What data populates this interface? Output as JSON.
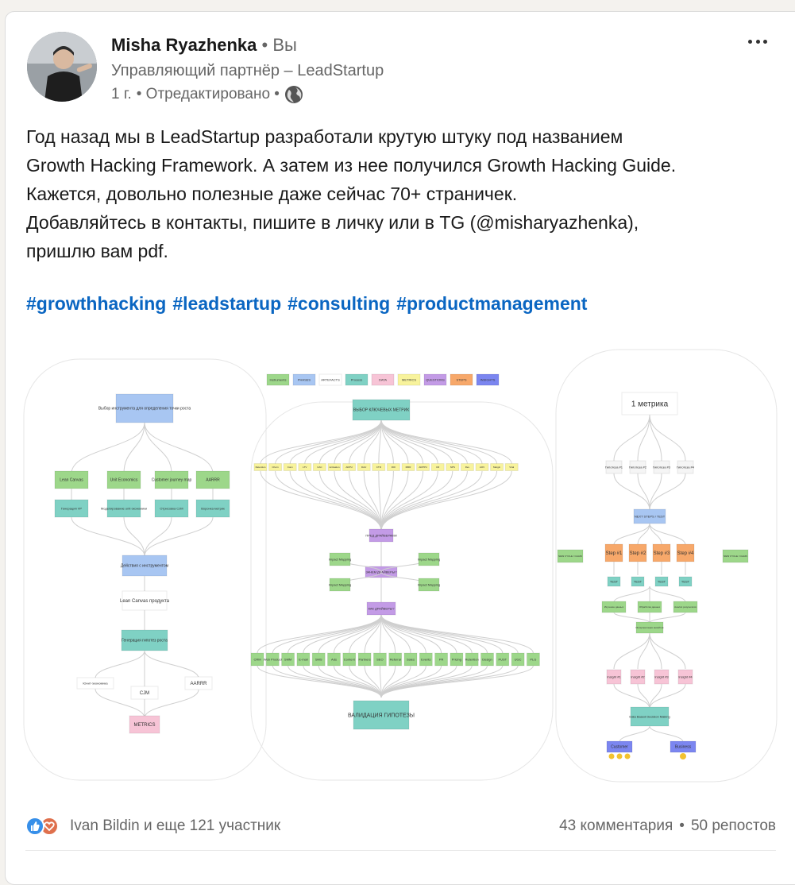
{
  "post": {
    "author_name": "Misha Ryazhenka",
    "author_badge": "• Вы",
    "author_headline": "Управляющий партнёр – LeadStartup",
    "time": "1 г.",
    "edited": "• Отредактировано •",
    "body_lines": [
      "Год назад мы в LeadStartup разработали крутую штуку под названием",
      "Growth Hacking Framework. А затем из нее получился Growth Hacking Guide.",
      "Кажется, довольно полезные даже сейчас 70+ страничек.",
      "Добавляйтесь в контакты, пишите в личку или в TG (@misharyazhenka),",
      "пришлю вам pdf."
    ],
    "hashtags": [
      "#growthhacking",
      "#leadstartup",
      "#consulting",
      "#productmanagement"
    ]
  },
  "framework": {
    "legend": [
      "Instruments",
      "PHASES",
      "ARTEFACTS",
      "Process",
      "DATA",
      "METRICS",
      "QUESTIONS",
      "STEPS",
      "INSIGHTS"
    ],
    "left": {
      "top": "Выбор инструмента для определения точки роста",
      "tools": [
        "Lean Canvas",
        "Unit Economics",
        "Customer journey map",
        "AARRR"
      ],
      "artefacts": [
        "Генерация VP",
        "Моделирование unit-экономики",
        "Отрисовка CJM",
        "Воронка метрик"
      ],
      "action": "Действия с инструментом",
      "lean_canvas": "Lean Canvas продукта",
      "generation": "Генерация гипотез роста",
      "unit_econ": "Юнит-экономика",
      "cjm": "CJM",
      "aarrr": "AARRR",
      "metrics": "METRICS"
    },
    "middle": {
      "top": "ВЫБОР КЛЮЧЕВЫХ МЕТРИК",
      "metric_chips": [
        "Retention",
        "Churn",
        "Conv",
        "LTV",
        "CAC",
        "Activation",
        "ARPU",
        "DAU",
        "CTR",
        "ROI",
        "MRR",
        "ARPPU",
        "CR",
        "NPS",
        "Rev",
        "AOV",
        "Margin",
        "Viral"
      ],
      "pre_drivers": "ПРЕД ДРАЙВЕРАМИ",
      "why_drivers": "ЗАЧЕМ ДРАЙВЕРЫ?",
      "how_drivers": "КАК ДРАЙВЕРЫ?",
      "impact": [
        "Impact Mapping",
        "Impact Mapping",
        "Impact Mapping",
        "Impact Mapping"
      ],
      "channels": [
        "CRM",
        "Web Product",
        "SMM",
        "E-mail",
        "SMS",
        "Ads",
        "Content",
        "Partners",
        "SEO",
        "Referral",
        "Sales",
        "Events",
        "PR",
        "Pricing",
        "Retention",
        "Design",
        "PUST",
        "UGC",
        "PLG"
      ],
      "validation": "ВАЛИДАЦИЯ ГИПОТЕЗЫ"
    },
    "right": {
      "top": "1 метрика",
      "hypotheses": [
        "Гипотеза #1",
        "Гипотеза #2",
        "Гипотеза #3",
        "Гипотеза #4"
      ],
      "next_steps": "NEXT STEPS / TEST",
      "steps": [
        "Step #1",
        "Step #2",
        "Step #3",
        "Step #4"
      ],
      "tests": [
        "TEST",
        "TEST",
        "TEST",
        "TEST"
      ],
      "processing": [
        "Изучение данных",
        "Обработка данных",
        "Анализ результатов"
      ],
      "interp": "Интерпретация инсайтов",
      "insights": [
        "Insight #1",
        "Insight #2",
        "Insight #3",
        "Insight #4"
      ],
      "ddm": "Data Based Decision Making",
      "customer": "Customer",
      "business": "Business",
      "side_left": "NEW CYCLE / CHAIN",
      "side_right": "NEW CYCLE / CHAIN"
    }
  },
  "social": {
    "reactions_text": "Ivan Bildin и еще 121 участник",
    "comments": "43 комментария",
    "separator": "•",
    "reposts": "50 репостов"
  },
  "colors": {
    "link": "#0a66c2",
    "muted": "#666666",
    "green": "#9dd78a",
    "teal": "#7fd1c4",
    "blue": "#a8c6f2",
    "pink": "#f7c4d6",
    "orange": "#f7a86a",
    "yellow": "#f8f39c",
    "purple": "#c39be6",
    "indigo": "#7b86f0"
  }
}
